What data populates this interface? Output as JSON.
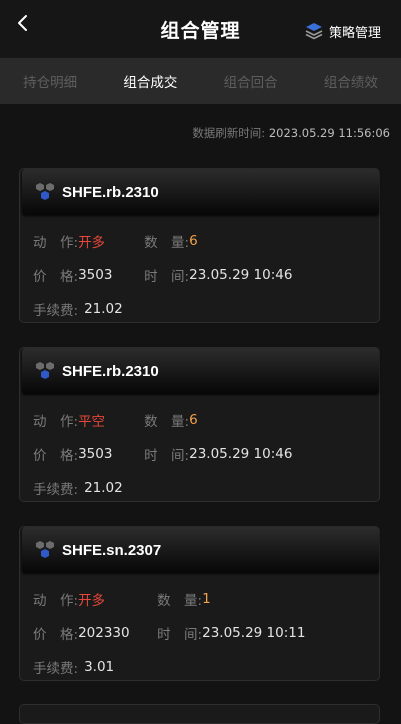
{
  "header": {
    "title": "组合管理",
    "strategy_label": "策略管理"
  },
  "tabs": [
    {
      "label": "持仓明细",
      "active": false
    },
    {
      "label": "组合成交",
      "active": true
    },
    {
      "label": "组合回合",
      "active": false
    },
    {
      "label": "组合绩效",
      "active": false
    }
  ],
  "refresh": {
    "label": "数据刷新时间:",
    "time": "2023.05.29 11:56:06"
  },
  "labels": {
    "action": "动　作:",
    "quantity": "数　量:",
    "price": "价　格:",
    "time": "时　间:",
    "fee": "手续费:"
  },
  "trades": [
    {
      "symbol": "SHFE.rb.2310",
      "action": "开多",
      "quantity": "6",
      "price": "3503",
      "time": "23.05.29 10:46",
      "fee": "21.02"
    },
    {
      "symbol": "SHFE.rb.2310",
      "action": "平空",
      "quantity": "6",
      "price": "3503",
      "time": "23.05.29 10:46",
      "fee": "21.02"
    },
    {
      "symbol": "SHFE.sn.2307",
      "action": "开多",
      "quantity": "1",
      "price": "202330",
      "time": "23.05.29 10:11",
      "fee": "3.01"
    }
  ],
  "colors": {
    "background": "#131313",
    "action": "#e6483a",
    "quantity": "#f0a14a",
    "tab_active": "#ffffff",
    "tab_inactive": "#5e5e5e"
  }
}
